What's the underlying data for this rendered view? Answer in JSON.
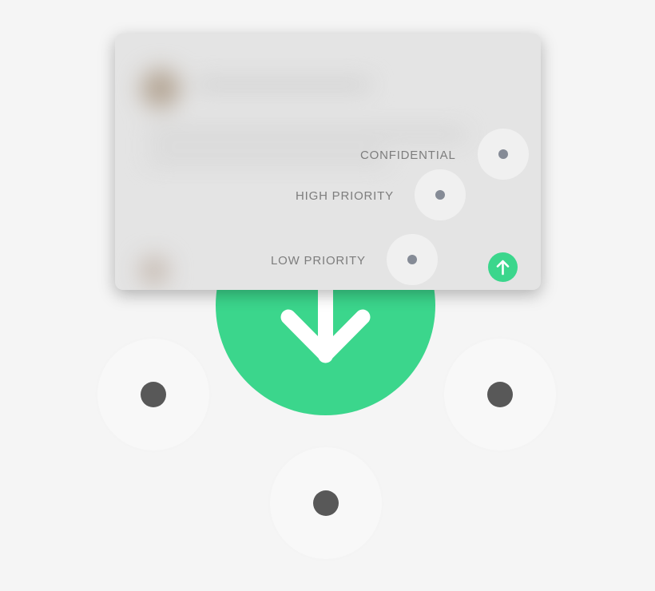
{
  "colors": {
    "accent": "#3bd68c",
    "option_dot": "#858b96",
    "background_dot": "#585858",
    "label": "#7d7d7d"
  },
  "main_action": {
    "icon": "arrow-down-icon"
  },
  "background_options": [
    {
      "name": "left",
      "icon": "dot-icon"
    },
    {
      "name": "right",
      "icon": "dot-icon"
    },
    {
      "name": "bottom",
      "icon": "dot-icon"
    }
  ],
  "priority_menu": {
    "options": [
      {
        "label": "CONFIDENTIAL",
        "icon": "dot-icon"
      },
      {
        "label": "HIGH PRIORITY",
        "icon": "dot-icon"
      },
      {
        "label": "LOW PRIORITY",
        "icon": "dot-icon"
      }
    ],
    "send": {
      "icon": "arrow-up-icon"
    }
  }
}
